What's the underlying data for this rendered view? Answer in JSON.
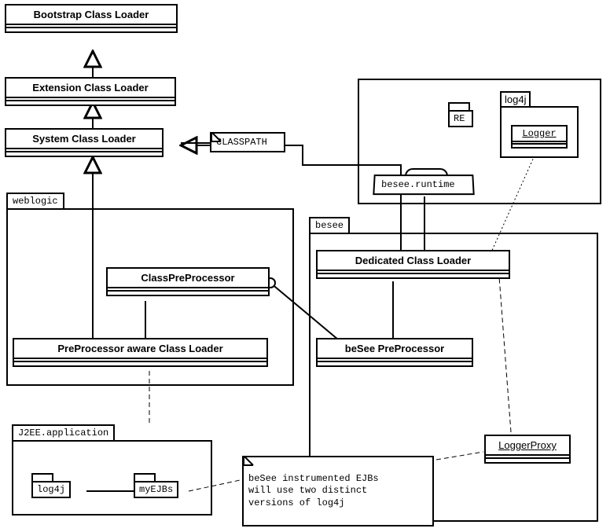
{
  "classes": {
    "bootstrap": "Bootstrap Class Loader",
    "extension": "Extension Class Loader",
    "system": "System Class Loader",
    "cpp": "ClassPreProcessor",
    "ppacl": "PreProcessor aware Class Loader",
    "dcl": "Dedicated Class Loader",
    "bpp": "beSee PreProcessor",
    "loggerProxy": "LoggerProxy"
  },
  "notes": {
    "classpath": "CLASSPATH",
    "comment": "beSee instrumented EJBs\nwill use two distinct\nversions of log4j"
  },
  "containers": {
    "weblogic": "weblogic",
    "besee": "besee",
    "j2ee": "J2EE.application"
  },
  "packages": {
    "re": "RE",
    "log4j_top": "log4j",
    "logger": "Logger",
    "log4j_app": "log4j",
    "myejbs": "myEJBs"
  },
  "folder": {
    "runtime": "besee.runtime"
  }
}
